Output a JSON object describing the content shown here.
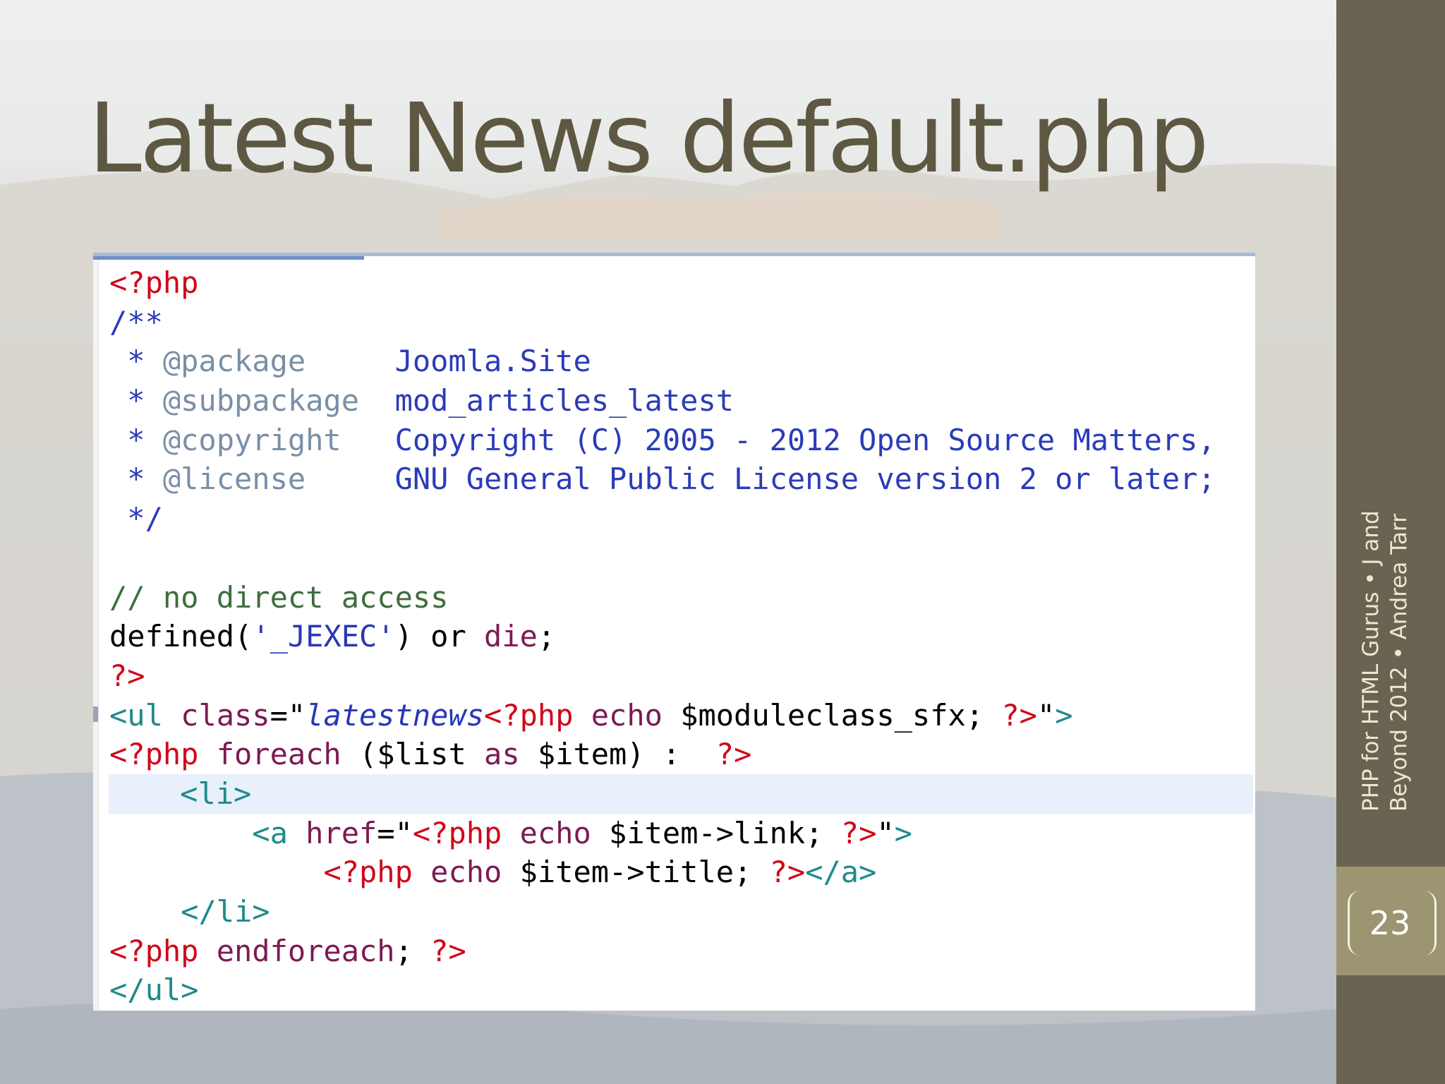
{
  "slide": {
    "title": "Latest News default.php",
    "footer_line1": "PHP for HTML Gurus • J and",
    "footer_line2": "Beyond 2012 • Andrea Tarr",
    "page_number": "23"
  },
  "code": {
    "lines": [
      [
        {
          "c": "kw",
          "t": "<?php"
        }
      ],
      [
        {
          "c": "dc",
          "t": "/**"
        }
      ],
      [
        {
          "c": "dc",
          "t": " * "
        },
        {
          "c": "tg",
          "t": "@package"
        },
        {
          "c": "dc",
          "t": "     Joomla.Site"
        }
      ],
      [
        {
          "c": "dc",
          "t": " * "
        },
        {
          "c": "tg",
          "t": "@subpackage"
        },
        {
          "c": "dc",
          "t": "  mod_articles_latest"
        }
      ],
      [
        {
          "c": "dc",
          "t": " * "
        },
        {
          "c": "tg",
          "t": "@copyright"
        },
        {
          "c": "dc",
          "t": "   Copyright (C) 2005 - 2012 Open Source Matters,"
        }
      ],
      [
        {
          "c": "dc",
          "t": " * "
        },
        {
          "c": "tg",
          "t": "@license"
        },
        {
          "c": "dc",
          "t": "     GNU General Public License version 2 or later;"
        }
      ],
      [
        {
          "c": "dc",
          "t": " */"
        }
      ],
      [
        {
          "c": "",
          "t": " "
        }
      ],
      [
        {
          "c": "cm",
          "t": "// no direct access"
        }
      ],
      [
        {
          "c": "",
          "t": "defined("
        },
        {
          "c": "st",
          "t": "'_JEXEC'"
        },
        {
          "c": "",
          "t": ") or "
        },
        {
          "c": "fn",
          "t": "die"
        },
        {
          "c": "",
          "t": ";"
        }
      ],
      [
        {
          "c": "kw",
          "t": "?>"
        }
      ],
      [
        {
          "c": "tag",
          "t": "<ul "
        },
        {
          "c": "att",
          "t": "class"
        },
        {
          "c": "",
          "t": "=\""
        },
        {
          "c": "it",
          "t": "latestnews"
        },
        {
          "c": "kw",
          "t": "<?php "
        },
        {
          "c": "fn",
          "t": "echo "
        },
        {
          "c": "",
          "t": "$moduleclass_sfx; "
        },
        {
          "c": "kw",
          "t": "?>"
        },
        {
          "c": "",
          "t": "\""
        },
        {
          "c": "tag",
          "t": ">"
        }
      ],
      [
        {
          "c": "kw",
          "t": "<?php "
        },
        {
          "c": "fn",
          "t": "foreach"
        },
        {
          "c": "",
          "t": " ($list "
        },
        {
          "c": "fn",
          "t": "as"
        },
        {
          "c": "",
          "t": " $item) :  "
        },
        {
          "c": "kw",
          "t": "?>"
        }
      ],
      [
        {
          "c": "",
          "t": "    "
        },
        {
          "c": "tag",
          "t": "<li>"
        }
      ],
      [
        {
          "c": "",
          "t": "        "
        },
        {
          "c": "tag",
          "t": "<a "
        },
        {
          "c": "att",
          "t": "href"
        },
        {
          "c": "",
          "t": "=\""
        },
        {
          "c": "kw",
          "t": "<?php "
        },
        {
          "c": "fn",
          "t": "echo "
        },
        {
          "c": "",
          "t": "$item->link; "
        },
        {
          "c": "kw",
          "t": "?>"
        },
        {
          "c": "",
          "t": "\""
        },
        {
          "c": "tag",
          "t": ">"
        }
      ],
      [
        {
          "c": "",
          "t": "            "
        },
        {
          "c": "kw",
          "t": "<?php "
        },
        {
          "c": "fn",
          "t": "echo "
        },
        {
          "c": "",
          "t": "$item->title; "
        },
        {
          "c": "kw",
          "t": "?>"
        },
        {
          "c": "tag",
          "t": "</a>"
        }
      ],
      [
        {
          "c": "",
          "t": "    "
        },
        {
          "c": "tag",
          "t": "</li>"
        }
      ],
      [
        {
          "c": "kw",
          "t": "<?php "
        },
        {
          "c": "fn",
          "t": "endforeach"
        },
        {
          "c": "",
          "t": "; "
        },
        {
          "c": "kw",
          "t": "?>"
        }
      ],
      [
        {
          "c": "tag",
          "t": "</ul>"
        }
      ]
    ],
    "highlighted_line": 13
  }
}
